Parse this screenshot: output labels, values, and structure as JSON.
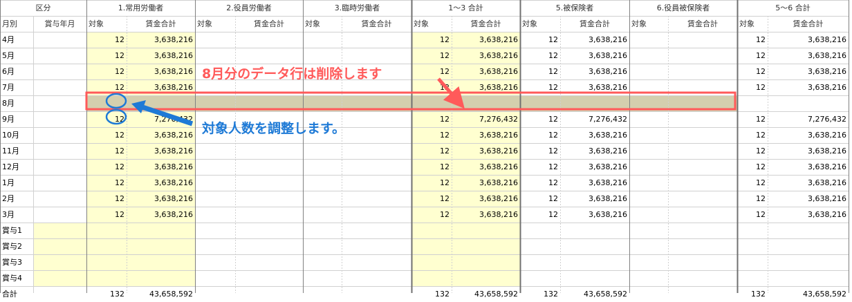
{
  "header": {
    "kubun": "区分",
    "groups": [
      "1.常用労働者",
      "2.役員労働者",
      "3.臨時労働者",
      "1〜3 合計",
      "5.被保険者",
      "6.役員被保険者",
      "5〜6 合計"
    ],
    "row_label": "月別",
    "bonus_month": "賞与年月",
    "sub_count": "対象",
    "sub_wage": "賃金合計"
  },
  "rows": [
    {
      "label": "4月",
      "vals": [
        "12",
        "3,638,216",
        "",
        "",
        "",
        "",
        "12",
        "3,638,216",
        "12",
        "3,638,216",
        "",
        "",
        "12",
        "3,638,216"
      ]
    },
    {
      "label": "5月",
      "vals": [
        "12",
        "3,638,216",
        "",
        "",
        "",
        "",
        "12",
        "3,638,216",
        "12",
        "3,638,216",
        "",
        "",
        "12",
        "3,638,216"
      ]
    },
    {
      "label": "6月",
      "vals": [
        "12",
        "3,638,216",
        "",
        "",
        "",
        "",
        "12",
        "3,638,216",
        "12",
        "3,638,216",
        "",
        "",
        "12",
        "3,638,216"
      ]
    },
    {
      "label": "7月",
      "vals": [
        "12",
        "3,638,216",
        "",
        "",
        "",
        "",
        "12",
        "3,638,216",
        "12",
        "3,638,216",
        "",
        "",
        "12",
        "3,638,216"
      ]
    },
    {
      "label": "8月",
      "vals": [
        "",
        "",
        "",
        "",
        "",
        "",
        "",
        "",
        "",
        "",
        "",
        "",
        "",
        ""
      ]
    },
    {
      "label": "9月",
      "vals": [
        "12",
        "7,276,432",
        "",
        "",
        "",
        "",
        "12",
        "7,276,432",
        "12",
        "7,276,432",
        "",
        "",
        "12",
        "7,276,432"
      ]
    },
    {
      "label": "10月",
      "vals": [
        "12",
        "3,638,216",
        "",
        "",
        "",
        "",
        "12",
        "3,638,216",
        "12",
        "3,638,216",
        "",
        "",
        "12",
        "3,638,216"
      ]
    },
    {
      "label": "11月",
      "vals": [
        "12",
        "3,638,216",
        "",
        "",
        "",
        "",
        "12",
        "3,638,216",
        "12",
        "3,638,216",
        "",
        "",
        "12",
        "3,638,216"
      ]
    },
    {
      "label": "12月",
      "vals": [
        "12",
        "3,638,216",
        "",
        "",
        "",
        "",
        "12",
        "3,638,216",
        "12",
        "3,638,216",
        "",
        "",
        "12",
        "3,638,216"
      ]
    },
    {
      "label": "1月",
      "vals": [
        "12",
        "3,638,216",
        "",
        "",
        "",
        "",
        "12",
        "3,638,216",
        "12",
        "3,638,216",
        "",
        "",
        "12",
        "3,638,216"
      ]
    },
    {
      "label": "2月",
      "vals": [
        "12",
        "3,638,216",
        "",
        "",
        "",
        "",
        "12",
        "3,638,216",
        "12",
        "3,638,216",
        "",
        "",
        "12",
        "3,638,216"
      ]
    },
    {
      "label": "3月",
      "vals": [
        "12",
        "3,638,216",
        "",
        "",
        "",
        "",
        "12",
        "3,638,216",
        "12",
        "3,638,216",
        "",
        "",
        "12",
        "3,638,216"
      ]
    },
    {
      "label": "賞与1",
      "vals": [
        "",
        "",
        "",
        "",
        "",
        "",
        "",
        "",
        "",
        "",
        "",
        "",
        "",
        ""
      ]
    },
    {
      "label": "賞与2",
      "vals": [
        "",
        "",
        "",
        "",
        "",
        "",
        "",
        "",
        "",
        "",
        "",
        "",
        "",
        ""
      ]
    },
    {
      "label": "賞与3",
      "vals": [
        "",
        "",
        "",
        "",
        "",
        "",
        "",
        "",
        "",
        "",
        "",
        "",
        "",
        ""
      ]
    },
    {
      "label": "賞与4",
      "vals": [
        "",
        "",
        "",
        "",
        "",
        "",
        "",
        "",
        "",
        "",
        "",
        "",
        "",
        ""
      ]
    },
    {
      "label": "合計",
      "vals": [
        "132",
        "43,658,592",
        "",
        "",
        "",
        "",
        "132",
        "43,658,592",
        "132",
        "43,658,592",
        "",
        "",
        "132",
        "43,658,592"
      ]
    }
  ],
  "notes": {
    "delete_row": "8月分のデータ行は削除します",
    "adjust_count": "対象人数を調整します。"
  },
  "colors": {
    "input_fill": "#ffffd0",
    "selected_row_fill": "#d4cfae",
    "selected_row_border": "#ff5a5a",
    "annotation_red": "#ff5a5a",
    "annotation_blue": "#1e7ad6",
    "gridline": "#d0d0d0",
    "group_divider": "#808080"
  }
}
